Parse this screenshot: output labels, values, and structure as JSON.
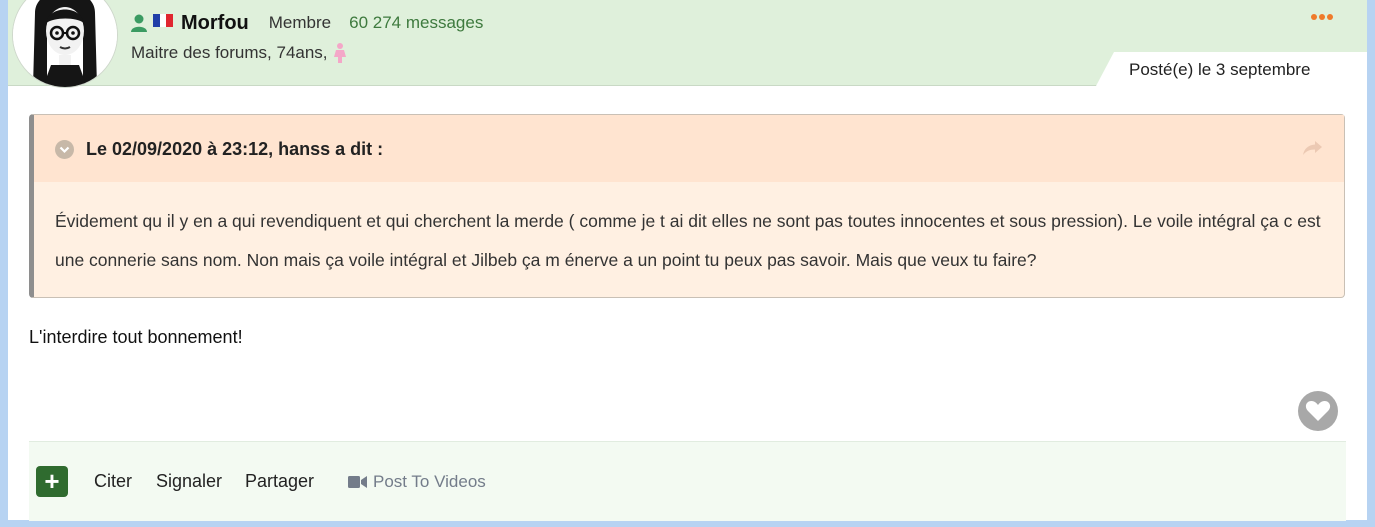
{
  "user": {
    "name": "Morfou",
    "role": "Membre",
    "message_count": "60 274 messages",
    "subtitle": "Maitre des forums, 74ans,"
  },
  "post": {
    "date": "Posté(e) le 3 septembre",
    "reply_text": "L'interdire tout bonnement!"
  },
  "quote": {
    "title": "Le 02/09/2020 à 23:12, hanss a dit :",
    "body": "Évidement qu il y en a qui revendiquent et qui cherchent la merde ( comme je t ai dit elles ne sont pas toutes innocentes et sous pression). Le voile intégral ça c est une connerie sans nom. Non mais ça voile intégral et Jilbeb ça m énerve a un point tu peux pas savoir. Mais que veux tu faire?"
  },
  "actions": {
    "quote": "Citer",
    "report": "Signaler",
    "share": "Partager",
    "video": "Post To Videos"
  },
  "colors": {
    "accent_green": "#2f6b2f",
    "header_bg": "#dff0db",
    "quote_bg": "#fff0e2",
    "dots_orange": "#ef7a2a"
  },
  "icons": [
    "user-icon",
    "france-flag-icon",
    "female-icon",
    "more-options-icon",
    "chevron-down-icon",
    "share-icon",
    "heart-icon",
    "plus-icon",
    "video-camera-icon"
  ]
}
